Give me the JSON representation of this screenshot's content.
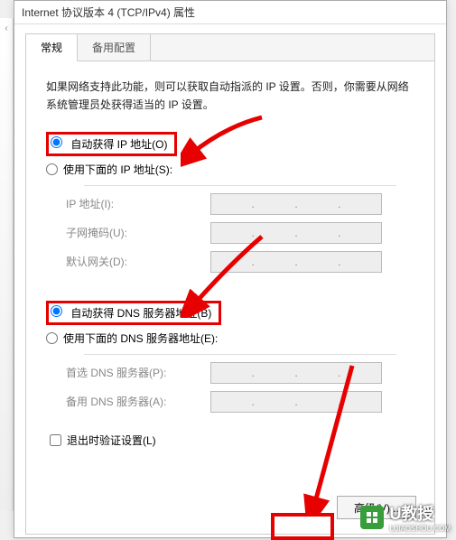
{
  "window_title": "Internet 协议版本 4 (TCP/IPv4) 属性",
  "tabs": {
    "general": "常规",
    "alternate": "备用配置"
  },
  "description": "如果网络支持此功能，则可以获取自动指派的 IP 设置。否则，你需要从网络系统管理员处获得适当的 IP 设置。",
  "ip": {
    "auto": "自动获得 IP 地址(O)",
    "manual": "使用下面的 IP 地址(S):",
    "addr_label": "IP 地址(I):",
    "mask_label": "子网掩码(U):",
    "gw_label": "默认网关(D):"
  },
  "dns": {
    "auto": "自动获得 DNS 服务器地址(B)",
    "manual": "使用下面的 DNS 服务器地址(E):",
    "pref_label": "首选 DNS 服务器(P):",
    "alt_label": "备用 DNS 服务器(A):"
  },
  "validate": "退出时验证设置(L)",
  "advanced_btn": "高级(V)...",
  "watermark": {
    "text": "U教授",
    "sub": "UJIAOSHOU.COM"
  }
}
